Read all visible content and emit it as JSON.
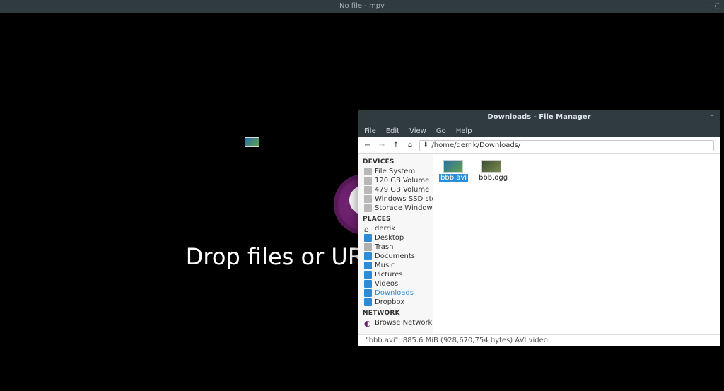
{
  "mpv": {
    "title": "No file - mpv",
    "drop_text": "Drop files or URLs to play here."
  },
  "fm": {
    "title": "Downloads - File Manager",
    "menu": {
      "file": "File",
      "edit": "Edit",
      "view": "View",
      "go": "Go",
      "help": "Help"
    },
    "path": "/home/derrik/Downloads/",
    "sidebar": {
      "devices_head": "DEVICES",
      "devices": [
        {
          "label": "File System"
        },
        {
          "label": "120 GB Volume"
        },
        {
          "label": "479 GB Volume"
        },
        {
          "label": "Windows SSD storage"
        },
        {
          "label": "Storage Windows"
        }
      ],
      "places_head": "PLACES",
      "places": [
        {
          "label": "derrik"
        },
        {
          "label": "Desktop"
        },
        {
          "label": "Trash"
        },
        {
          "label": "Documents"
        },
        {
          "label": "Music"
        },
        {
          "label": "Pictures"
        },
        {
          "label": "Videos"
        },
        {
          "label": "Downloads"
        },
        {
          "label": "Dropbox"
        }
      ],
      "network_head": "NETWORK",
      "network": [
        {
          "label": "Browse Network"
        }
      ]
    },
    "files": [
      {
        "name": "bbb.avi",
        "selected": true
      },
      {
        "name": "bbb.ogg",
        "selected": false
      }
    ],
    "statusbar": "\"bbb.avi\": 885.6 MiB (928,670,754 bytes) AVI video"
  }
}
